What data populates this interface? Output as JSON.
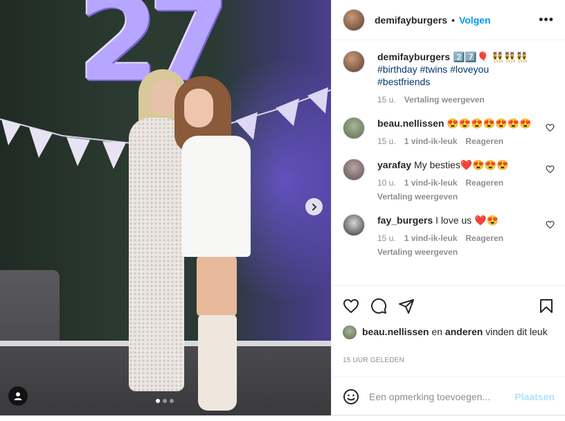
{
  "post": {
    "author": "demifayburgers",
    "follow_label": "Volgen",
    "separator": "•",
    "more_icon": "more-icon"
  },
  "caption": {
    "user": "demifayburgers",
    "text": "2️⃣7️⃣🎈 👯👯👯",
    "hashtags": [
      "#birthday",
      "#twins",
      "#loveyou",
      "#bestfriends"
    ],
    "time": "15 u.",
    "translate": "Vertaling weergeven"
  },
  "comments": [
    {
      "user": "beau.nellissen",
      "text": "😍😍😍😍😍😍😍",
      "time": "15 u.",
      "likes": "1 vind-ik-leuk",
      "reply": "Reageren",
      "translate": ""
    },
    {
      "user": "yarafay",
      "text": "My besties❤️😍😍😍",
      "time": "10 u.",
      "likes": "1 vind-ik-leuk",
      "reply": "Reageren",
      "translate": "Vertaling weergeven"
    },
    {
      "user": "fay_burgers",
      "text": "I love us ❤️😍",
      "time": "15 u.",
      "likes": "1 vind-ik-leuk",
      "reply": "Reageren",
      "translate": "Vertaling weergeven"
    }
  ],
  "likes": {
    "user": "beau.nellissen",
    "joiner": "en",
    "others": "anderen",
    "suffix": "vinden dit leuk"
  },
  "timestamp": "15 UUR GELEDEN",
  "add_comment": {
    "placeholder": "Een opmerking toevoegen...",
    "post_label": "Plaatsen"
  },
  "photo": {
    "balloon_digits": [
      "2",
      "7"
    ],
    "carousel_index": 1,
    "carousel_count": 3
  },
  "colors": {
    "link": "#0095f6",
    "hashtag": "#00376b",
    "muted": "#8e8e8e",
    "post_disabled": "#b2dffc"
  }
}
